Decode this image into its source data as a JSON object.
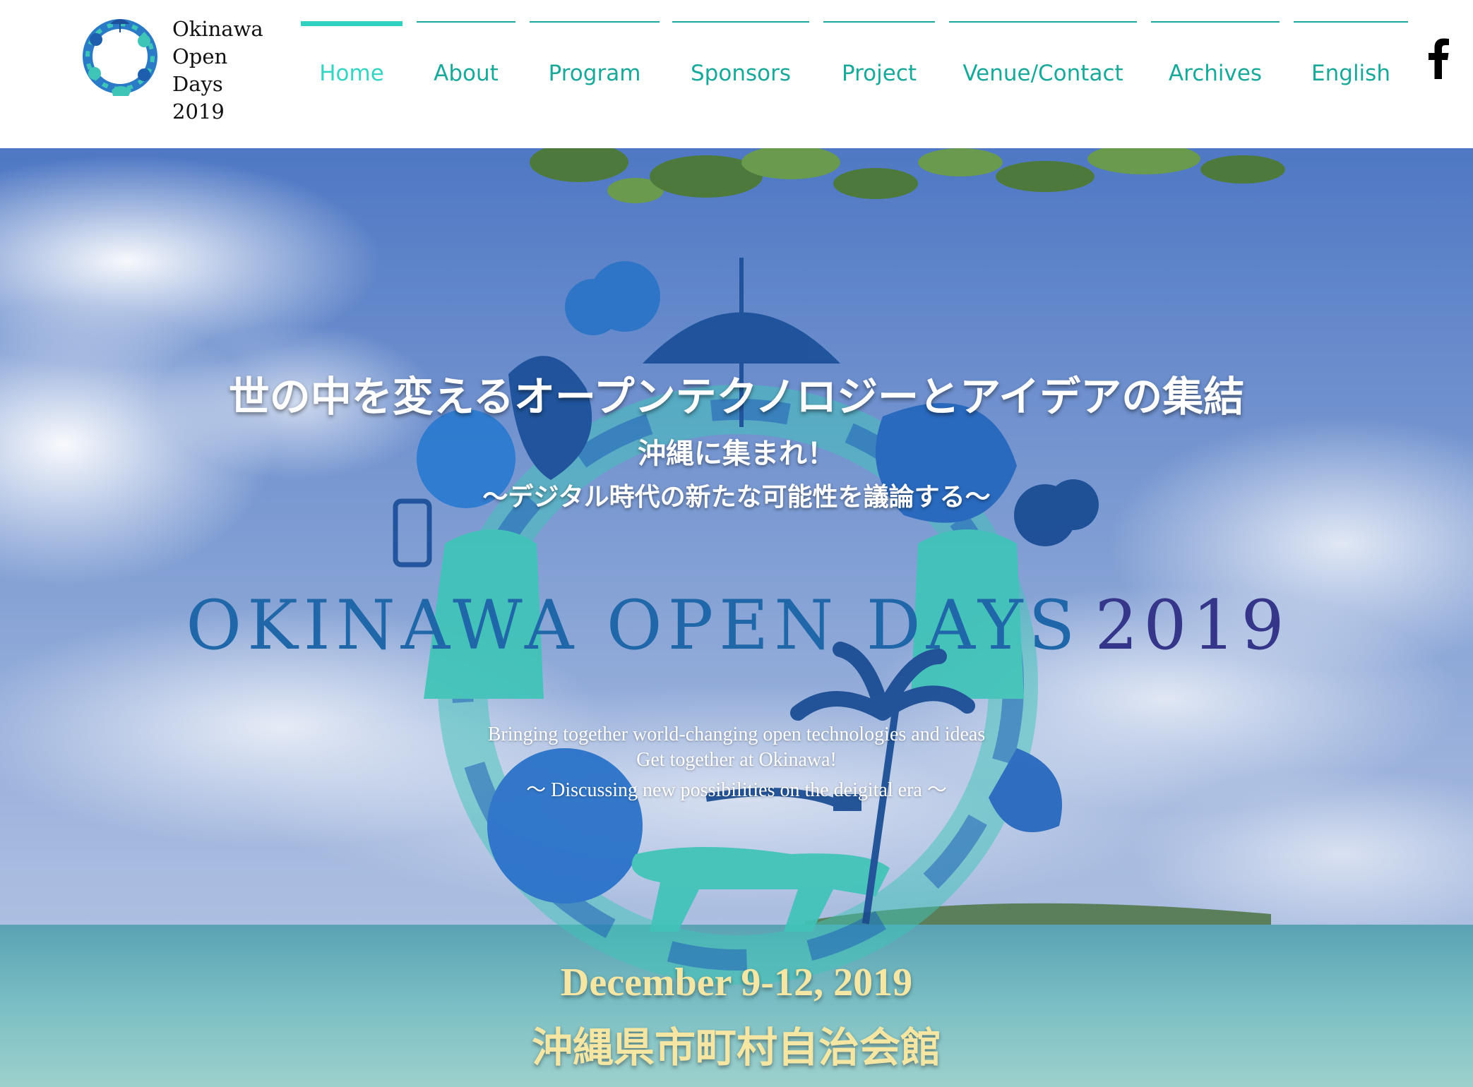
{
  "brand": {
    "name_lines": [
      "Okinawa",
      "Open",
      "Days 2019"
    ]
  },
  "nav": {
    "items": [
      {
        "label": "Home",
        "active": true
      },
      {
        "label": "About",
        "active": false
      },
      {
        "label": "Program",
        "active": false
      },
      {
        "label": "Sponsors",
        "active": false
      },
      {
        "label": "Project",
        "active": false
      },
      {
        "label": "Venue/Contact",
        "active": false
      },
      {
        "label": "Archives",
        "active": false
      },
      {
        "label": "English",
        "active": false
      }
    ]
  },
  "social": {
    "icon": "facebook-icon"
  },
  "hero": {
    "title_ja": "世の中を変えるオープンテクノロジーとアイデアの集結",
    "subtitle_ja_1": "沖縄に集まれ！",
    "subtitle_ja_2": "〜デジタル時代の新たな可能性を議論する〜",
    "logo_text": "OKINAWA OPEN DAYS",
    "logo_year": "2019",
    "tagline_en_1": "Bringing together world-changing open technologies and ideas",
    "tagline_en_2": "Get together at Okinawa!",
    "tagline_en_3": "〜 Discussing new possibilities on the deigital era 〜",
    "date": "December 9-12, 2019",
    "venue_ja": "沖縄県市町村自治会館"
  },
  "colors": {
    "accent": "#2fd1c0",
    "nav_text": "#19a89a",
    "logo_blue": "#1f67a8",
    "logo_year": "#35358a",
    "highlight": "#f5e7a3"
  }
}
